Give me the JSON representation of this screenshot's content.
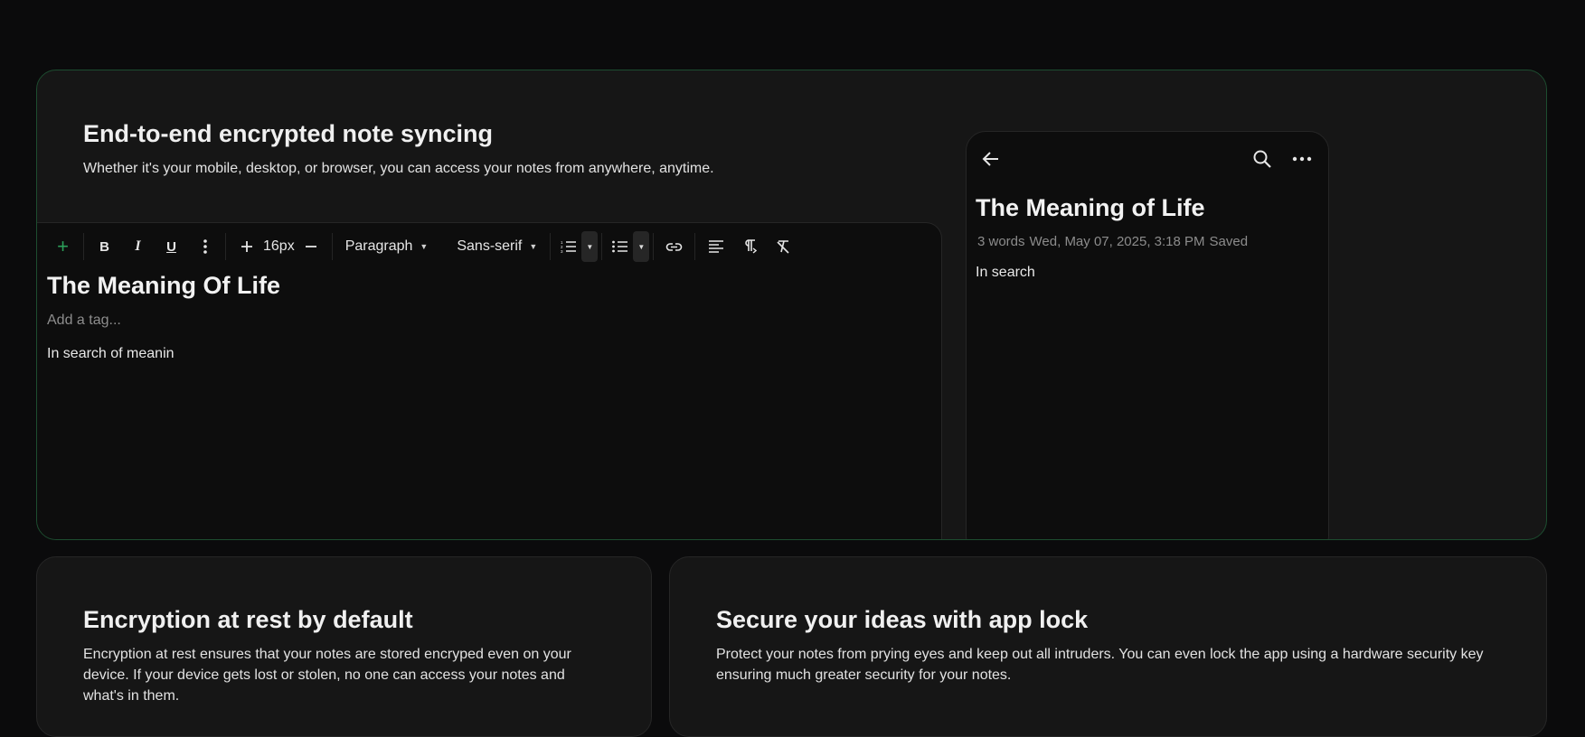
{
  "hero": {
    "title": "End-to-end encrypted note syncing",
    "description": "Whether it's your mobile, desktop, or browser, you can access your notes from anywhere, anytime."
  },
  "toolbar": {
    "font_size": "16px",
    "block_type": "Paragraph",
    "font_family": "Sans-serif",
    "icons": [
      "add-icon",
      "bold-icon",
      "italic-icon",
      "underline-icon",
      "more-vertical-icon",
      "increase-font-icon",
      "decrease-font-icon",
      "numbered-list-icon",
      "bullet-list-icon",
      "link-icon",
      "align-left-icon",
      "text-direction-icon",
      "clear-formatting-icon"
    ]
  },
  "editor": {
    "title": "The Meaning Of Life",
    "tag_placeholder": "Add a tag...",
    "body": "In search of meanin"
  },
  "phone": {
    "title": "The Meaning of Life",
    "word_count": "3 words",
    "timestamp": "Wed, May 07, 2025, 3:18 PM",
    "status": "Saved",
    "body": "In search"
  },
  "features": {
    "encryption": {
      "title": "Encryption at rest by default",
      "description": "Encryption at rest ensures that your notes are stored encryped even on your device. If your device gets lost or stolen, no one can access your notes and what's in them."
    },
    "app_lock": {
      "title": "Secure your ideas with app lock",
      "description": "Protect your notes from prying eyes and keep out all intruders. You can even lock the app using a hardware security key ensuring much greater security for your notes."
    }
  },
  "colors": {
    "background": "#0b0b0c",
    "card": "#161616",
    "editor": "#0d0d0d",
    "accent": "#2ca05a",
    "hero_border": "#1d4d30"
  }
}
